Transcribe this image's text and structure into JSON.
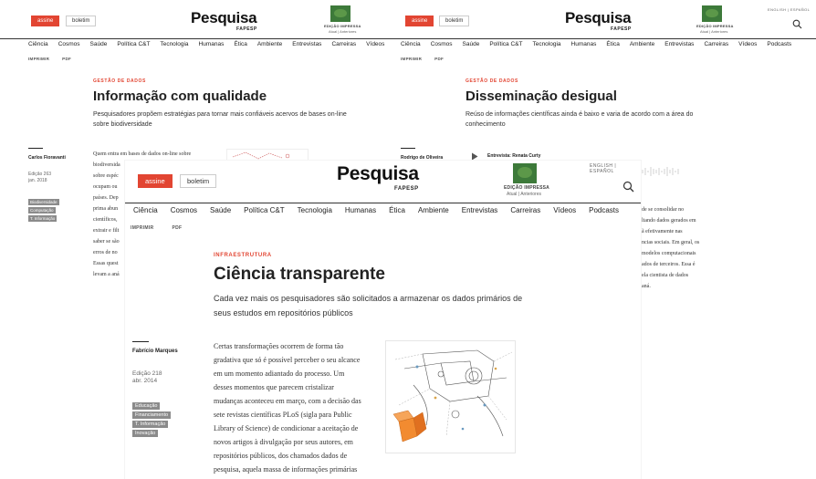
{
  "colors": {
    "accent": "#e24532",
    "tag": "#8b8b8b",
    "rule": "#333333"
  },
  "header": {
    "assine": "assine",
    "boletim": "boletim",
    "logo": "Pesquisa",
    "logo_sub": "FAPESP",
    "edicao": "EDIÇÃO IMPRESSA",
    "edicao_links": "Atual | Anteriores",
    "languages": "ENGLISH | ESPAÑOL",
    "search_icon": "search-icon"
  },
  "nav": [
    "Ciência",
    "Cosmos",
    "Saúde",
    "Política C&T",
    "Tecnologia",
    "Humanas",
    "Ética",
    "Ambiente",
    "Entrevistas",
    "Carreiras",
    "Vídeos",
    "Podcasts"
  ],
  "sub_nav": [
    "IMPRIMIR",
    "PDF"
  ],
  "article_a": {
    "kicker": "GESTÃO DE DADOS",
    "title": "Informação com qualidade",
    "dek": "Pesquisadores propõem estratégias para tornar mais confiáveis acervos de bases on-line sobre biodiversidade",
    "author": "Carlos Fioravanti",
    "edition": "Edição 263",
    "date": "jan. 2018",
    "tags": [
      "Biodiversidade",
      "Computação",
      "T. Informação"
    ],
    "body_lines": [
      "Quem entra em bases de dados on-line sobre",
      "biodiversida",
      "sobre espéc",
      "ocupam ou",
      "países. Dep",
      "prima abun",
      "científicos,",
      "extrair e filt",
      "saber se são",
      "erros de no",
      "Essas quest",
      "levam a aná"
    ]
  },
  "article_b": {
    "kicker": "GESTÃO DE DADOS",
    "title": "Disseminação desigual",
    "dek": "Reúso de informações científicas ainda é baixo e varia de acordo com a área do conhecimento",
    "author": "Rodrigo de Oliveira",
    "audio_label": "Entrevista: Renata Curty",
    "play_icon": "play-icon",
    "body_fragments": [
      "de se consolidar no",
      "ltando dados gerados em",
      "ã efetivamente nas",
      "ncias sociais. Em geral, os",
      "modelos computacionais",
      "ados de terceiros. Essa é",
      "ela cientista de dados",
      "aná."
    ]
  },
  "article_c": {
    "kicker": "INFRAESTRUTURA",
    "title": "Ciência transparente",
    "dek": "Cada vez mais os pesquisadores são solicitados a armazenar os dados primários de seus estudos em repositórios públicos",
    "author": "Fabrício Marques",
    "edition": "Edição 218",
    "date": "abr. 2014",
    "tags": [
      "Educação",
      "Financiamento",
      "T. Informação",
      "Inovação"
    ],
    "body_lines": [
      "Certas transformações ocorrem de forma tão",
      "gradativa que só é possível perceber o seu alcance",
      "em um momento adiantado do processo. Um",
      "desses momentos que parecem cristalizar",
      "mudanças aconteceu em março, com a decisão das",
      "sete revistas científicas PLoS (sigla para Public",
      "Library of Science) de condicionar a aceitação de",
      "novos artigos à divulgação por seus autores, em",
      "repositórios públicos, dos chamados dados de",
      "pesquisa, aquela massa de informações primárias"
    ]
  }
}
